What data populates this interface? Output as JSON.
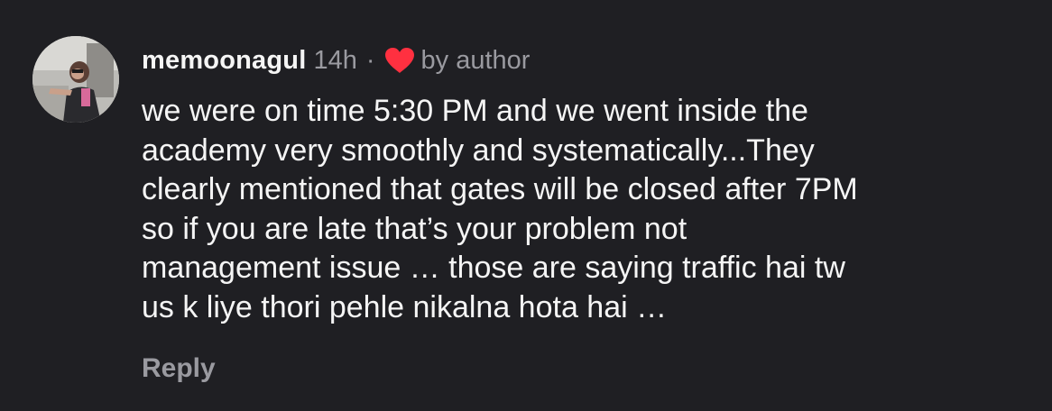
{
  "comment": {
    "username": "memoonagul",
    "timestamp": "14h",
    "separator": "·",
    "liked_by_author_icon": "heart-icon",
    "liked_by_author_label": "by author",
    "heart_color": "#ff3040",
    "body_lines": [
      "we were on time 5:30 PM and we went inside the",
      "academy very smoothly and systematically...They",
      "clearly mentioned that gates will be closed after 7PM",
      "so if you are late that’s your problem not",
      "management issue … those are saying traffic hai tw",
      "us k liye thori pehle nikalna hota hai …"
    ],
    "reply_label": "Reply"
  }
}
